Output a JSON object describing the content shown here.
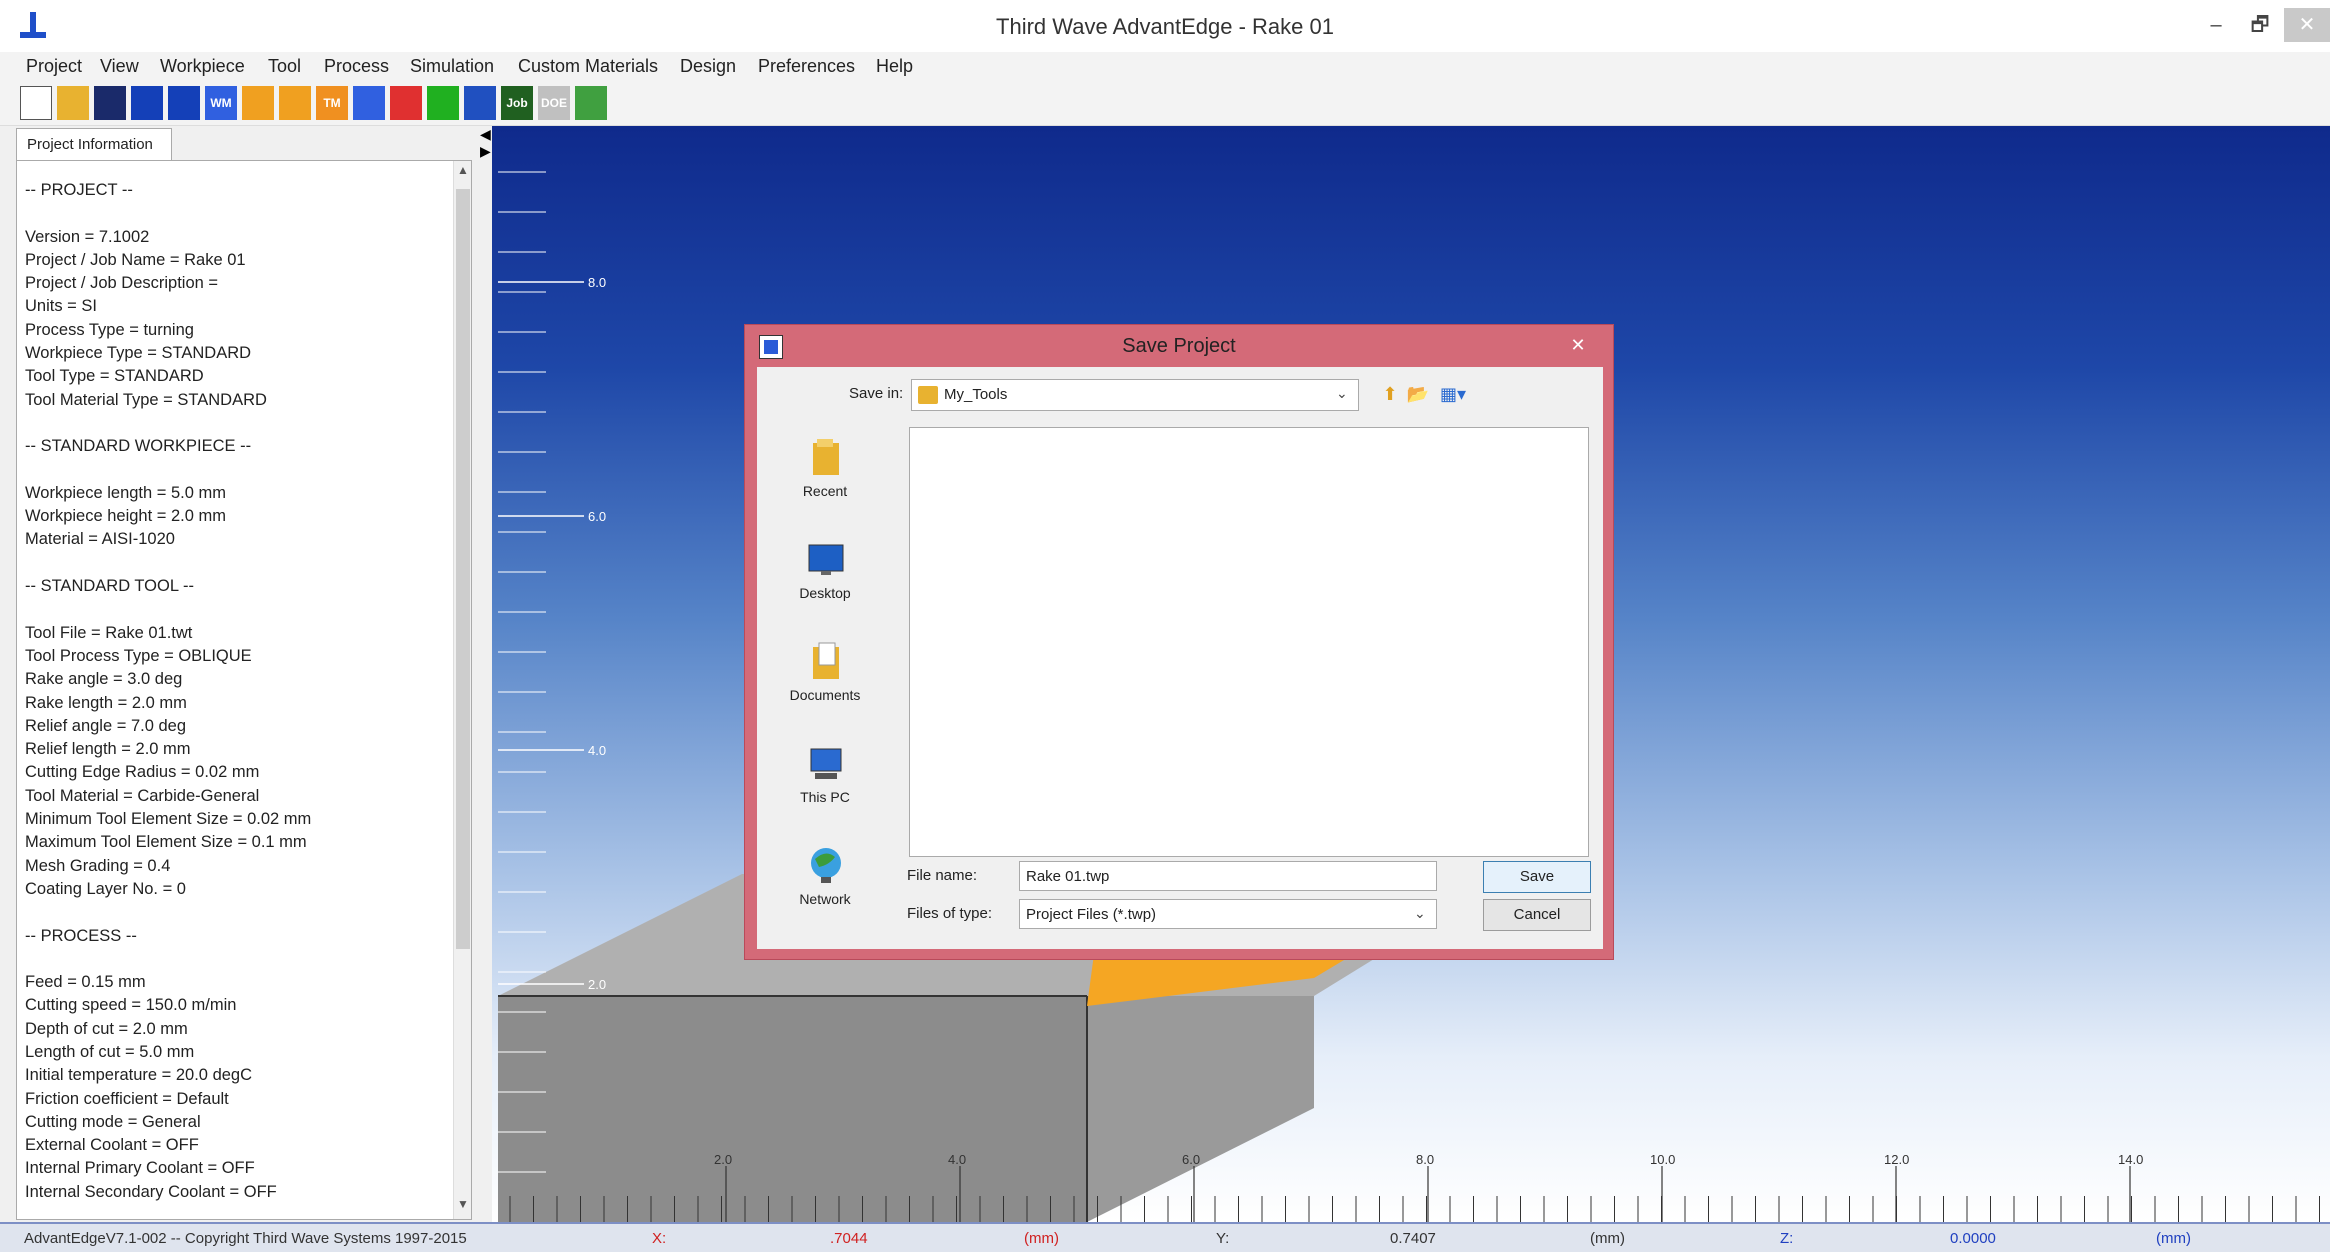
{
  "window": {
    "title": "Third Wave AdvantEdge - Rake 01",
    "min_glyph": "–",
    "max_glyph": "🗗",
    "close_glyph": "✕"
  },
  "menu": [
    "Project",
    "View",
    "Workpiece",
    "Tool",
    "Process",
    "Simulation",
    "Custom Materials",
    "Design",
    "Preferences",
    "Help"
  ],
  "toolbar": {
    "icons": [
      {
        "name": "new-project-icon",
        "color": "#ffffff",
        "label": ""
      },
      {
        "name": "open-folder-icon",
        "color": "#e8b230",
        "label": ""
      },
      {
        "name": "save-disk-icon",
        "color": "#1a2a6a",
        "label": ""
      },
      {
        "name": "tool-shape-icon",
        "color": "#1440b8",
        "label": ""
      },
      {
        "name": "tool-shape-alt-icon",
        "color": "#1440b8",
        "label": ""
      },
      {
        "name": "workpiece-material-icon",
        "color": "#3060e0",
        "label": "WM"
      },
      {
        "name": "tool-edit-icon",
        "color": "#f0a020",
        "label": ""
      },
      {
        "name": "tool-holder-icon",
        "color": "#f0a020",
        "label": ""
      },
      {
        "name": "tool-material-icon",
        "color": "#f09020",
        "label": "TM"
      },
      {
        "name": "process-icon",
        "color": "#3060e0",
        "label": ""
      },
      {
        "name": "simulation-icon",
        "color": "#e03030",
        "label": ""
      },
      {
        "name": "run-simulation-icon",
        "color": "#20b020",
        "label": ""
      },
      {
        "name": "tool-view-icon",
        "color": "#2050c0",
        "label": ""
      },
      {
        "name": "job-icon",
        "color": "#206020",
        "label": "Job"
      },
      {
        "name": "doe-icon",
        "color": "#c0c0c0",
        "label": "DOE"
      },
      {
        "name": "refresh-icon",
        "color": "#40a040",
        "label": ""
      }
    ]
  },
  "panel": {
    "tab_label": "Project Information",
    "lines": [
      "-- PROJECT --",
      "",
      "Version = 7.1002",
      "Project / Job Name  = Rake 01",
      "Project / Job Description  =",
      "Units = SI",
      "Process Type = turning",
      "Workpiece Type = STANDARD",
      "Tool Type = STANDARD",
      "Tool Material Type = STANDARD",
      "",
      "-- STANDARD WORKPIECE --",
      "",
      "Workpiece length = 5.0 mm",
      "Workpiece height = 2.0 mm",
      "Material = AISI-1020",
      "",
      "-- STANDARD TOOL --",
      "",
      "Tool File = Rake 01.twt",
      "Tool Process Type = OBLIQUE",
      "Rake angle = 3.0 deg",
      "Rake length = 2.0 mm",
      "Relief angle = 7.0 deg",
      "Relief length = 2.0 mm",
      "Cutting Edge Radius = 0.02 mm",
      "Tool Material = Carbide-General",
      "Minimum Tool Element Size = 0.02 mm",
      "Maximum Tool Element Size = 0.1 mm",
      "Mesh Grading = 0.4",
      "Coating Layer No. = 0",
      "",
      "-- PROCESS --",
      "",
      "Feed = 0.15 mm",
      "Cutting speed = 150.0 m/min",
      "Depth of cut = 2.0 mm",
      "Length of cut = 5.0 mm",
      "Initial temperature = 20.0 degC",
      "Friction coefficient = Default",
      "Cutting mode = General",
      "External Coolant = OFF",
      "Internal Primary Coolant = OFF",
      "Internal Secondary Coolant = OFF"
    ]
  },
  "viewport": {
    "y_ticks": [
      "8.0",
      "6.0",
      "4.0",
      "2.0"
    ],
    "x_ticks": [
      "2.0",
      "4.0",
      "6.0",
      "8.0",
      "10.0",
      "12.0",
      "14.0"
    ],
    "workpiece_color": "#8c8c8c",
    "tool_color": "#f5a623"
  },
  "status": {
    "copyright": "AdvantEdgeV7.1-002 -- Copyright Third Wave Systems 1997-2015",
    "x_label": "X:",
    "x_value": ".7044",
    "x_unit": "(mm)",
    "y_label": "Y:",
    "y_value": "0.7407",
    "y_unit": "(mm)",
    "z_label": "Z:",
    "z_value": "0.0000",
    "z_unit": "(mm)"
  },
  "dialog": {
    "title": "Save Project",
    "close_glyph": "✕",
    "save_in_label": "Save in:",
    "save_in_value": "My_Tools",
    "places": [
      "Recent",
      "Desktop",
      "Documents",
      "This PC",
      "Network"
    ],
    "file_name_label": "File name:",
    "file_name_value": "Rake 01.twp",
    "file_type_label": "Files of type:",
    "file_type_value": "Project Files (*.twp)",
    "save_label": "Save",
    "cancel_label": "Cancel"
  }
}
